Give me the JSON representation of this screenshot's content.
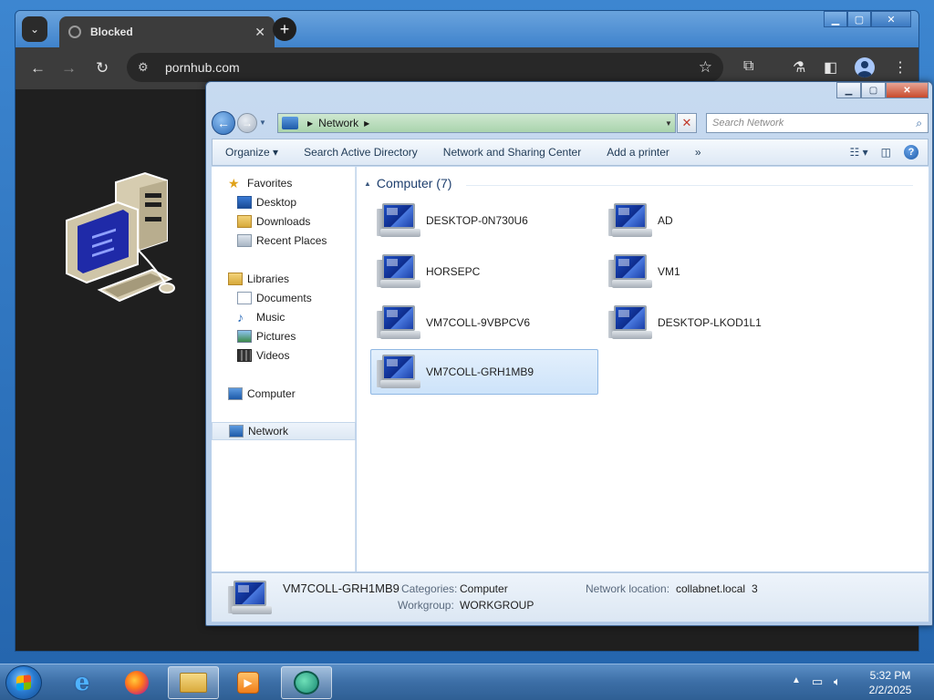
{
  "browser": {
    "tab_title": "Blocked",
    "url": "pornhub.com"
  },
  "explorer": {
    "address": "Network",
    "search_placeholder": "Search Network",
    "commands": [
      "Organize",
      "Search Active Directory",
      "Network and Sharing Center",
      "Add a printer",
      "»"
    ],
    "nav": {
      "favorites": "Favorites",
      "desktop": "Desktop",
      "downloads": "Downloads",
      "recent": "Recent Places",
      "libraries": "Libraries",
      "documents": "Documents",
      "music": "Music",
      "pictures": "Pictures",
      "videos": "Videos",
      "computer": "Computer",
      "network": "Network"
    },
    "group_header": "Computer (7)",
    "computers": [
      "DESKTOP-0N730U6",
      "AD",
      "HORSEPC",
      "VM1",
      "VM7COLL-9VBPCV6",
      "DESKTOP-LKOD1L1",
      "VM7COLL-GRH1MB9"
    ],
    "selected": "VM7COLL-GRH1MB9",
    "details": {
      "name": "VM7COLL-GRH1MB9",
      "categories_label": "Categories:",
      "categories_value": "Computer",
      "workgroup_label": "Workgroup:",
      "workgroup_value": "WORKGROUP",
      "network_location_label": "Network location:",
      "network_location_value": "collabnet.local",
      "network_location_count": "3"
    }
  },
  "taskbar": {
    "time": "5:32 PM",
    "date": "2/2/2025"
  },
  "icons": {
    "start": "windows-start-icon",
    "ie": "internet-explorer-icon",
    "firefox": "firefox-icon",
    "explorer": "folder-icon",
    "media": "media-player-icon",
    "app": "green-app-icon"
  }
}
